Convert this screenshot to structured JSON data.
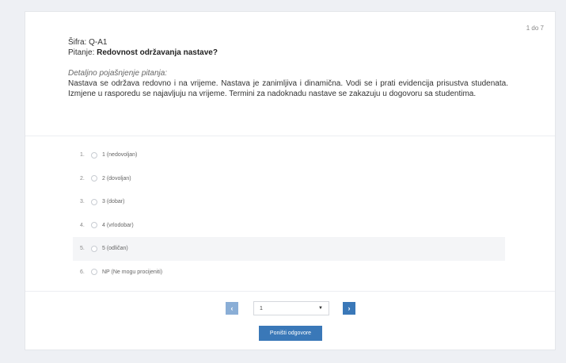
{
  "page_counter": "1 do 7",
  "question": {
    "code_label": "Šifra:",
    "code_value": "Q-A1",
    "question_label": "Pitanje:",
    "question_text": "Redovnost održavanja nastave?",
    "explanation_label": "Detaljno pojašnjenje pitanja:",
    "explanation_text": "Nastava se održava redovno i na vrijeme. Nastava je zanimljiva i dinamična. Vodi se i prati evidencija prisustva studenata. Izmjene u rasporedu se najavljuju na vrijeme. Termini za nadoknadu nastave se zakazuju u dogovoru sa studentima."
  },
  "options": [
    {
      "num": "1.",
      "label": "1 (nedovoljan)"
    },
    {
      "num": "2.",
      "label": "2 (dovoljan)"
    },
    {
      "num": "3.",
      "label": "3 (dobar)"
    },
    {
      "num": "4.",
      "label": "4 (vrlodobar)"
    },
    {
      "num": "5.",
      "label": "5 (odličan)"
    },
    {
      "num": "6.",
      "label": "NP (Ne mogu procijeniti)"
    }
  ],
  "pager": {
    "prev_icon": "chevron-left-icon",
    "next_icon": "chevron-right-icon",
    "selected_page": "1"
  },
  "reset_label": "Poništi odgovore",
  "colors": {
    "primary": "#3a78b8",
    "primary_disabled": "#8aaed6",
    "background": "#eef0f4"
  }
}
